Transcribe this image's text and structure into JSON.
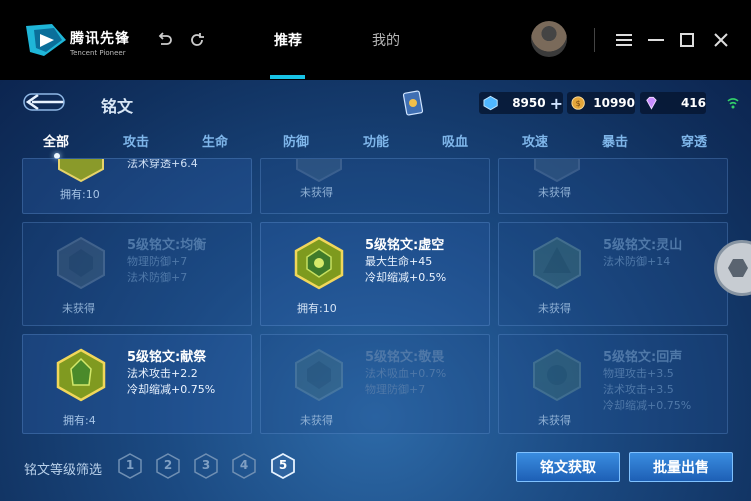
{
  "app": {
    "logo_cn": "腾讯先锋",
    "logo_en": "Tencent Pioneer",
    "tabs": [
      {
        "label": "推荐",
        "active": true
      },
      {
        "label": "我的",
        "active": false
      }
    ],
    "icons": [
      "undo-icon",
      "refresh-icon",
      "menu-icon",
      "minimize-icon",
      "maximize-icon",
      "close-icon"
    ]
  },
  "game": {
    "title": "铭文",
    "currencies": [
      {
        "icon": "crystal-icon",
        "value": "8950",
        "plus": "+",
        "color": "#4fb7ff"
      },
      {
        "icon": "coin-icon",
        "value": "10990",
        "color": "#e4a63a"
      },
      {
        "icon": "diamond-icon",
        "value": "416",
        "color": "#c78cff"
      }
    ],
    "categories": [
      "全部",
      "攻击",
      "生命",
      "防御",
      "功能",
      "吸血",
      "攻速",
      "暴击",
      "穿透"
    ],
    "active_category": "全部",
    "cards": [
      {
        "name": "",
        "stats": [
          "法术穿透+6.4"
        ],
        "owned": "拥有:10",
        "lit": true
      },
      {
        "name": "",
        "stats": [],
        "owned": "未获得",
        "lit": false
      },
      {
        "name": "",
        "stats": [],
        "owned": "未获得",
        "lit": false
      },
      {
        "name": "5级铭文:均衡",
        "stats": [
          "物理防御+7",
          "法术防御+7"
        ],
        "owned": "未获得",
        "lit": false
      },
      {
        "name": "5级铭文:虚空",
        "stats": [
          "最大生命+45",
          "冷却缩减+0.5%"
        ],
        "owned": "拥有:10",
        "lit": true
      },
      {
        "name": "5级铭文:灵山",
        "stats": [
          "法术防御+14"
        ],
        "owned": "未获得",
        "lit": false
      },
      {
        "name": "5级铭文:献祭",
        "stats": [
          "法术攻击+2.2",
          "冷却缩减+0.75%"
        ],
        "owned": "拥有:4",
        "lit": true
      },
      {
        "name": "5级铭文:敬畏",
        "stats": [
          "法术吸血+0.7%",
          "物理防御+7"
        ],
        "owned": "未获得",
        "lit": false
      },
      {
        "name": "5级铭文:回声",
        "stats": [
          "物理攻击+3.5",
          "法术攻击+3.5",
          "冷却缩减+0.75%"
        ],
        "owned": "未获得",
        "lit": false
      }
    ],
    "filter_label": "铭文等级筛选",
    "levels": [
      "1",
      "2",
      "3",
      "4",
      "5"
    ],
    "selected_level": "5",
    "buttons": {
      "acquire": "铭文获取",
      "bulk_sell": "批量出售"
    }
  }
}
